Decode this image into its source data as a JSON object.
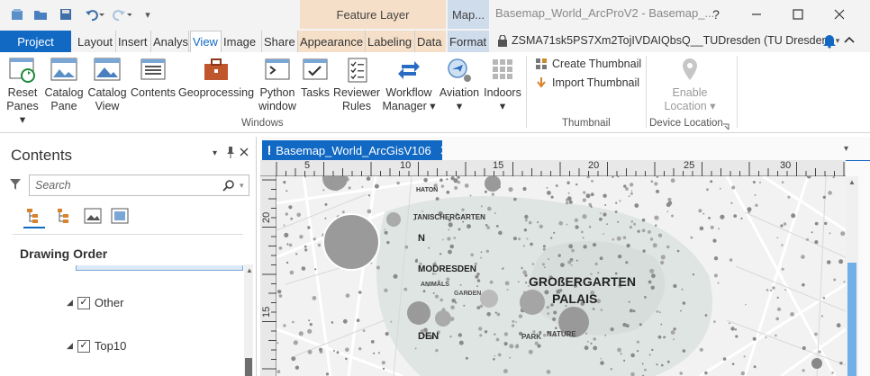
{
  "window": {
    "title": "Basemap_World_ArcProV2 - Basemap_...",
    "context_tabs": {
      "feature_layer": "Feature Layer",
      "map": "Map..."
    },
    "help": "?"
  },
  "tabs": {
    "project": "Project",
    "items": [
      "Layout",
      "Insert",
      "Analys",
      "View",
      "Image",
      "Share",
      "Appearance",
      "Labeling",
      "Data",
      "Format"
    ],
    "active": "View"
  },
  "user": {
    "name": "ZSMA71sk5PS7Xm2TojIVDAIQbsQ__TUDresden (TU Dresden)"
  },
  "ribbon": {
    "windows_group": {
      "label": "Windows",
      "buttons": [
        {
          "id": "reset-panes",
          "label": "Reset\nPanes ▾"
        },
        {
          "id": "catalog-pane",
          "label": "Catalog\nPane"
        },
        {
          "id": "catalog-view",
          "label": "Catalog\nView"
        },
        {
          "id": "contents",
          "label": "Contents"
        },
        {
          "id": "geoprocessing",
          "label": "Geoprocessing"
        },
        {
          "id": "python-window",
          "label": "Python\nwindow"
        },
        {
          "id": "tasks",
          "label": "Tasks"
        },
        {
          "id": "reviewer-rules",
          "label": "Reviewer\nRules"
        },
        {
          "id": "workflow-manager",
          "label": "Workflow\nManager ▾"
        },
        {
          "id": "aviation",
          "label": "Aviation\n▾"
        },
        {
          "id": "indoors",
          "label": "Indoors\n▾"
        }
      ]
    },
    "thumbnail_group": {
      "label": "Thumbnail",
      "create": "Create Thumbnail",
      "import": "Import Thumbnail"
    },
    "device_location_group": {
      "label": "Device Location",
      "enable": "Enable\nLocation ▾"
    }
  },
  "contents_pane": {
    "title": "Contents",
    "search_placeholder": "Search",
    "section": "Drawing Order",
    "layers": [
      {
        "name": "Other",
        "checked": true
      },
      {
        "name": "Top10",
        "checked": true
      }
    ]
  },
  "map_view": {
    "tab_label": "Basemap_World_ArcGisV106",
    "ruler_top": [
      "5",
      "10",
      "15",
      "20",
      "25",
      "30"
    ],
    "ruler_left": [
      "20",
      "15"
    ],
    "map_labels": {
      "big_1": "GROßERGARTEN",
      "big_2": "PALAIS",
      "label_n": "N",
      "label_modresden": "MODRESDEN",
      "label_den": "DEN",
      "label_garden": "GARDEN",
      "label_park": "PARK",
      "label_nature": "NATURE",
      "label_animals": "ANIMALS",
      "label_tanischergarten": "TANISCHERGARTEN",
      "label_haton": "HATON"
    }
  },
  "colors": {
    "accent": "#1169c4",
    "feature_layer_ctx": "#f5dfc8",
    "map_ctx": "#cfdcec"
  }
}
